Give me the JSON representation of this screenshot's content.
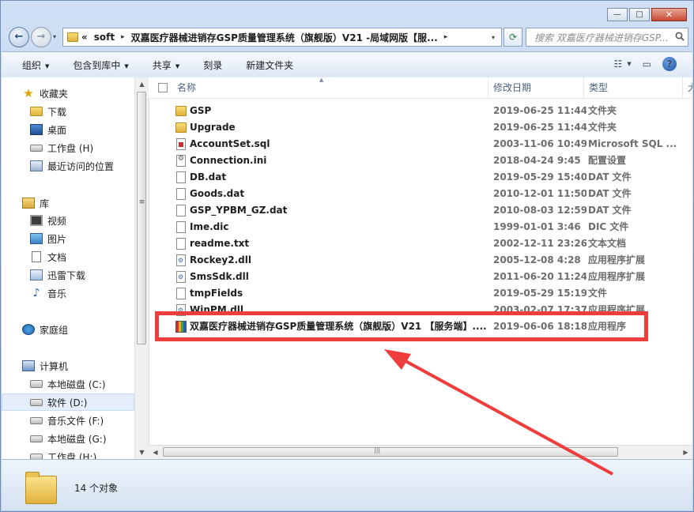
{
  "window": {
    "minimize_glyph": "—",
    "maximize_glyph": "□",
    "close_glyph": "✕"
  },
  "nav": {
    "back_glyph": "←",
    "forward_glyph": "→",
    "history_glyph": "▾"
  },
  "address": {
    "chevron": "«",
    "crumbs": [
      "soft",
      "双嘉医疗器械进销存GSP质量管理系统（旗舰版）V21 -局域网版【服..."
    ],
    "separator": "▸",
    "dropdown_glyph": "▾"
  },
  "refresh_glyph": "⟳",
  "search": {
    "placeholder": "搜索 双嘉医疗器械进销存GSP...",
    "icon": "search-icon"
  },
  "toolbar": {
    "organize": "组织",
    "include_library": "包含到库中",
    "share": "共享",
    "burn": "刻录",
    "new_folder": "新建文件夹",
    "dropdown_glyph": "▼",
    "view_glyph": "☷",
    "view_arrow": "▼",
    "preview_glyph": "▭",
    "help_glyph": "?"
  },
  "sidebar": {
    "favorites": "收藏夹",
    "downloads": "下载",
    "desktop": "桌面",
    "work_drive": "工作盘 (H)",
    "recent": "最近访问的位置",
    "libraries": "库",
    "videos": "视频",
    "pictures": "图片",
    "documents": "文档",
    "xunlei": "迅雷下载",
    "music": "音乐",
    "homegroup": "家庭组",
    "computer": "计算机",
    "drive_c": "本地磁盘 (C:)",
    "drive_d": "软件 (D:)",
    "drive_f": "音乐文件 (F:)",
    "drive_g": "本地磁盘 (G:)",
    "drive_h": "工作盘 (H:)",
    "star_glyph": "★",
    "music_glyph": "♪"
  },
  "columns": {
    "name": "名称",
    "date": "修改日期",
    "type": "类型",
    "size": "大"
  },
  "files": [
    {
      "name": "GSP",
      "date": "2019-06-25 11:44",
      "type": "文件夹",
      "icon": "folder"
    },
    {
      "name": "Upgrade",
      "date": "2019-06-25 11:44",
      "type": "文件夹",
      "icon": "folder"
    },
    {
      "name": "AccountSet.sql",
      "date": "2003-11-06 10:49",
      "type": "Microsoft SQL ...",
      "icon": "sql"
    },
    {
      "name": "Connection.ini",
      "date": "2018-04-24 9:45",
      "type": "配置设置",
      "icon": "cfg"
    },
    {
      "name": "DB.dat",
      "date": "2019-05-29 15:40",
      "type": "DAT 文件",
      "icon": "file"
    },
    {
      "name": "Goods.dat",
      "date": "2010-12-01 11:50",
      "type": "DAT 文件",
      "icon": "file"
    },
    {
      "name": "GSP_YPBM_GZ.dat",
      "date": "2010-08-03 12:59",
      "type": "DAT 文件",
      "icon": "file"
    },
    {
      "name": "Ime.dic",
      "date": "1999-01-01 3:46",
      "type": "DIC 文件",
      "icon": "file"
    },
    {
      "name": "readme.txt",
      "date": "2002-12-11 23:26",
      "type": "文本文档",
      "icon": "file"
    },
    {
      "name": "Rockey2.dll",
      "date": "2005-12-08 4:28",
      "type": "应用程序扩展",
      "icon": "dll"
    },
    {
      "name": "SmsSdk.dll",
      "date": "2011-06-20 11:24",
      "type": "应用程序扩展",
      "icon": "dll"
    },
    {
      "name": "tmpFields",
      "date": "2019-05-29 15:19",
      "type": "文件",
      "icon": "file"
    },
    {
      "name": "WinPM.dll",
      "date": "2003-02-07 17:37",
      "type": "应用程序扩展",
      "icon": "dll"
    },
    {
      "name": "双嘉医疗器械进销存GSP质量管理系统（旗舰版）V21 【服务端】....",
      "date": "2019-06-06 18:18",
      "type": "应用程序",
      "icon": "exe"
    }
  ],
  "scroll": {
    "up": "▲",
    "down": "▼",
    "left": "◀",
    "right": "▶",
    "grip_v": "≡",
    "grip_h": "|||"
  },
  "status": {
    "count": "14 个对象"
  },
  "colors": {
    "highlight": "#ee3d3d",
    "selection": "#e4eefb"
  }
}
